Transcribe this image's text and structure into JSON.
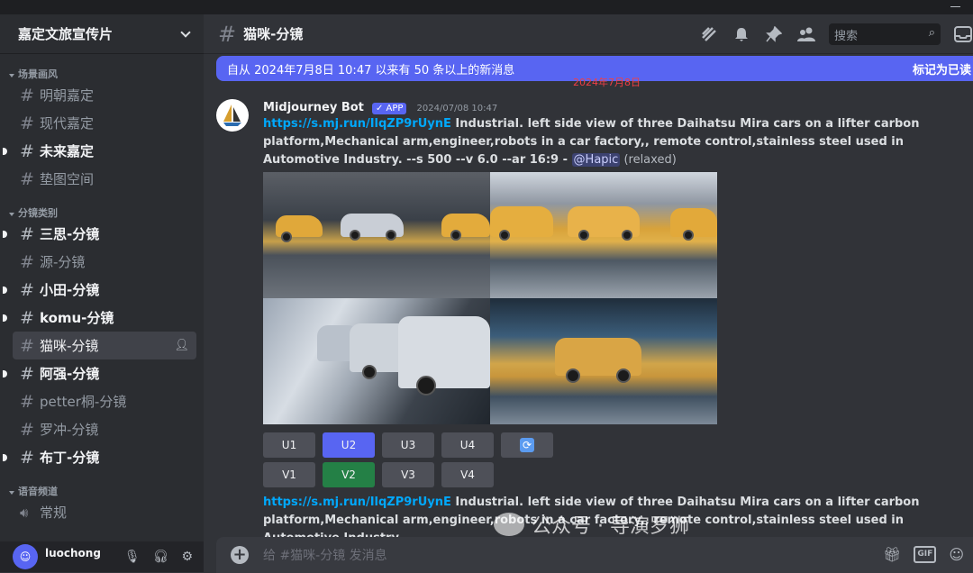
{
  "server": {
    "name": "嘉定文旅宣传片"
  },
  "categories": [
    {
      "label": "场景画风",
      "channels": [
        {
          "name": "明朝嘉定",
          "unread": false
        },
        {
          "name": "现代嘉定",
          "unread": false
        },
        {
          "name": "未来嘉定",
          "unread": true
        },
        {
          "name": "垫图空间",
          "unread": false
        }
      ]
    },
    {
      "label": "分镜类别",
      "channels": [
        {
          "name": "三思-分镜",
          "unread": true
        },
        {
          "name": "源-分镜",
          "unread": false
        },
        {
          "name": "小田-分镜",
          "unread": true
        },
        {
          "name": "komu-分镜",
          "unread": true
        },
        {
          "name": "猫咪-分镜",
          "unread": false,
          "active": true
        },
        {
          "name": "阿强-分镜",
          "unread": true
        },
        {
          "name": "petter桐-分镜",
          "unread": false
        },
        {
          "name": "罗冲-分镜",
          "unread": false
        },
        {
          "name": "布丁-分镜",
          "unread": true
        }
      ]
    },
    {
      "label": "语音频道",
      "channels": [
        {
          "name": "常规",
          "voice": true
        }
      ]
    }
  ],
  "user": {
    "name": "luochong"
  },
  "header": {
    "channel": "猫咪-分镜",
    "search_placeholder": "搜索"
  },
  "banner": {
    "text": "自从 2024年7月8日 10:47 以来有 50 条以上的新消息",
    "action": "标记为已读"
  },
  "date_divider": "2024年7月8日",
  "message": {
    "author": "Midjourney Bot",
    "badge": "✓ APP",
    "timestamp": "2024/07/08 10:47",
    "link": "https://s.mj.run/IlqZP9rUynE",
    "prompt": " Industrial. left side view of three Daihatsu Mira cars on a lifter carbon platform,Mechanical arm,engineer,robots in a car factory,, remote control,stainless steel used in Automotive Industry. --s 500 --v 6.0 --ar 16:9 - ",
    "mention": "@Hapic",
    "suffix": " (relaxed)",
    "upscale_buttons": [
      "U1",
      "U2",
      "U3",
      "U4"
    ],
    "variation_buttons": [
      "V1",
      "V2",
      "V3",
      "V4"
    ],
    "reroll_icon": "refresh-icon"
  },
  "message2": {
    "link": "https://s.mj.run/IlqZP9rUynE",
    "prompt": " Industrial. left side view of three Daihatsu Mira cars on a lifter carbon platform,Mechanical arm,engineer,robots in a car factory,, remote control,stainless steel used in Automotive Industry. -"
  },
  "composer": {
    "placeholder": "给 #猫咪-分镜 发消息"
  },
  "watermark": "公众号 · 导演罗狮",
  "colors": {
    "accent": "#5865f2",
    "link": "#00a8fc",
    "green": "#248046"
  }
}
